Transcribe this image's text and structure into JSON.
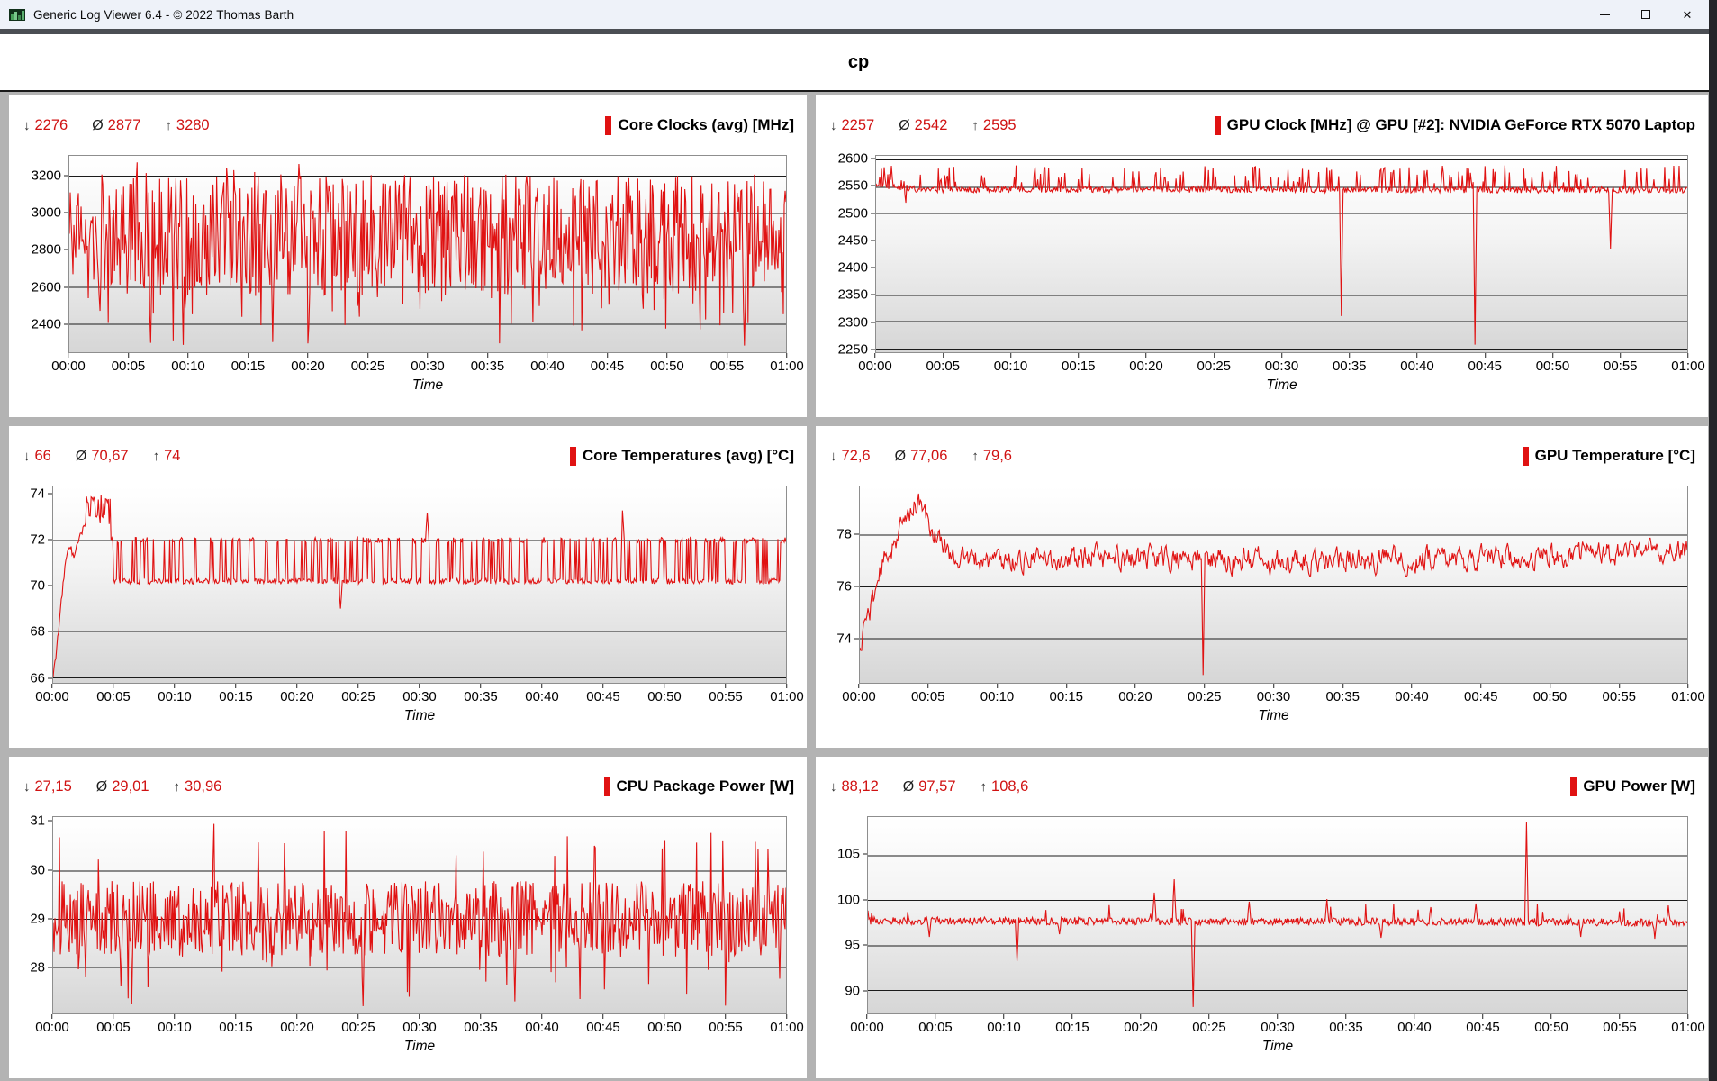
{
  "window": {
    "title": "Generic Log Viewer 6.4 - © 2022 Thomas Barth",
    "controls": {
      "minimize": "minimize",
      "maximize": "maximize",
      "close": "close",
      "close_glyph": "✕"
    }
  },
  "header": {
    "title": "cp"
  },
  "stats_symbols": {
    "min": "↓",
    "avg": "Ø",
    "max": "↑"
  },
  "colors": {
    "series_red": "#e01212",
    "stat_value_red": "#d01212",
    "grid_line": "#1b1b1b",
    "panel_bg": "#ffffff",
    "workspace_bg": "#b3b3b3"
  },
  "chart_data": [
    {
      "id": "core-clocks",
      "type": "line",
      "title": "Core Clocks (avg) [MHz]",
      "stats": {
        "min": "2276",
        "avg": "2877",
        "max": "3280"
      },
      "stats_numeric": {
        "min": 2276,
        "avg": 2877,
        "max": 3280
      },
      "y_ticks": [
        3200,
        3000,
        2800,
        2600,
        2400
      ],
      "y_range": [
        2245,
        3310
      ],
      "x_ticks": [
        "00:00",
        "00:05",
        "00:10",
        "00:15",
        "00:20",
        "00:25",
        "00:30",
        "00:35",
        "00:40",
        "00:45",
        "00:50",
        "00:55",
        "01:00"
      ],
      "x_label": "Time",
      "x_range_minutes": [
        0,
        60
      ],
      "profile": {
        "kind": "noise",
        "seed": 11,
        "base": 2880,
        "amp": 330,
        "high": {
          "p": 0.02,
          "range": [
            3180,
            3280
          ]
        },
        "low": {
          "p": 0.035,
          "range": [
            2380,
            2560
          ]
        },
        "deep": {
          "p": 0.006,
          "range": [
            2290,
            2420
          ]
        },
        "events": [
          [
            9.5,
            2285
          ],
          [
            17,
            2300
          ],
          [
            56.5,
            2281
          ]
        ],
        "clip": [
          2276,
          3280
        ]
      }
    },
    {
      "id": "gpu-clock",
      "type": "line",
      "title": "GPU Clock [MHz] @ GPU [#2]: NVIDIA GeForce RTX 5070 Laptop",
      "stats": {
        "min": "2257",
        "avg": "2542",
        "max": "2595"
      },
      "stats_numeric": {
        "min": 2257,
        "avg": 2542,
        "max": 2595
      },
      "y_ticks": [
        2600,
        2550,
        2500,
        2450,
        2400,
        2350,
        2300,
        2250
      ],
      "y_range": [
        2243,
        2607
      ],
      "x_ticks": [
        "00:00",
        "00:05",
        "00:10",
        "00:15",
        "00:20",
        "00:25",
        "00:30",
        "00:35",
        "00:40",
        "00:45",
        "00:50",
        "00:55",
        "01:00"
      ],
      "x_label": "Time",
      "x_range_minutes": [
        0,
        60
      ],
      "profile": {
        "kind": "flat",
        "seed": 22,
        "path": [
          [
            0,
            2554
          ],
          [
            1.5,
            2549
          ],
          [
            3,
            2545
          ],
          [
            60,
            2544
          ]
        ],
        "noise": 6,
        "spike": {
          "p": 0.16,
          "range": [
            12,
            45
          ]
        },
        "events": [
          [
            2.2,
            2520
          ],
          [
            34.4,
            2310
          ],
          [
            44.3,
            2257
          ],
          [
            54.3,
            2435
          ]
        ],
        "clip": [
          2257,
          2595
        ]
      }
    },
    {
      "id": "core-temperatures",
      "type": "line",
      "title": "Core Temperatures (avg) [°C]",
      "stats": {
        "min": "66",
        "avg": "70,67",
        "max": "74"
      },
      "stats_numeric": {
        "min": 66,
        "avg": 70.67,
        "max": 74
      },
      "y_ticks": [
        74,
        72,
        70,
        68,
        66
      ],
      "y_range": [
        65.75,
        74.35
      ],
      "x_ticks": [
        "00:00",
        "00:05",
        "00:10",
        "00:15",
        "00:20",
        "00:25",
        "00:30",
        "00:35",
        "00:40",
        "00:45",
        "00:50",
        "00:55",
        "01:00"
      ],
      "x_label": "Time",
      "x_range_minutes": [
        0,
        60
      ],
      "profile": {
        "kind": "square",
        "seed": 33,
        "ramp": [
          [
            0,
            66
          ],
          [
            0.4,
            67.8
          ],
          [
            0.9,
            70.5
          ],
          [
            1.3,
            71.9
          ],
          [
            1.7,
            71.2
          ],
          [
            2.1,
            72
          ],
          [
            2.6,
            72.6
          ]
        ],
        "burst_until": 4.7,
        "burst": [
          72.7,
          74.0
        ],
        "lo": 70.2,
        "hi": 72.0,
        "p_enter_hi": 0.22,
        "p_exit_hi": 0.45,
        "noise": 0.12,
        "events": [
          [
            23.5,
            69.0
          ],
          [
            30.6,
            73.2
          ],
          [
            46.6,
            73.3
          ]
        ],
        "clip": [
          66,
          74
        ]
      }
    },
    {
      "id": "gpu-temperature",
      "type": "line",
      "title": "GPU Temperature [°C]",
      "stats": {
        "min": "72,6",
        "avg": "77,06",
        "max": "79,6"
      },
      "stats_numeric": {
        "min": 72.6,
        "avg": 77.06,
        "max": 79.6
      },
      "y_ticks": [
        78,
        76,
        74
      ],
      "y_range": [
        72.3,
        79.85
      ],
      "x_ticks": [
        "00:00",
        "00:05",
        "00:10",
        "00:15",
        "00:20",
        "00:25",
        "00:30",
        "00:35",
        "00:40",
        "00:45",
        "00:50",
        "00:55",
        "01:00"
      ],
      "x_label": "Time",
      "x_range_minutes": [
        0,
        60
      ],
      "profile": {
        "kind": "wander",
        "seed": 44,
        "path": [
          [
            0,
            73.4
          ],
          [
            0.3,
            74.6
          ],
          [
            0.8,
            75.2
          ],
          [
            1.5,
            76.6
          ],
          [
            2.3,
            77.6
          ],
          [
            3.2,
            78.4
          ],
          [
            4.0,
            79.3
          ],
          [
            4.5,
            79.0
          ],
          [
            5.2,
            78.2
          ],
          [
            6.5,
            77.3
          ],
          [
            8,
            77.0
          ],
          [
            20,
            77.1
          ],
          [
            30,
            77.0
          ],
          [
            45,
            77.1
          ],
          [
            60,
            77.4
          ]
        ],
        "noise": 0.42,
        "events": [
          [
            24.9,
            72.6
          ]
        ],
        "clip": [
          72.6,
          79.6
        ]
      }
    },
    {
      "id": "cpu-package-power",
      "type": "line",
      "title": "CPU Package Power [W]",
      "stats": {
        "min": "27,15",
        "avg": "29,01",
        "max": "30,96"
      },
      "stats_numeric": {
        "min": 27.15,
        "avg": 29.01,
        "max": 30.96
      },
      "y_ticks": [
        31,
        30,
        29,
        28
      ],
      "y_range": [
        27.05,
        31.1
      ],
      "x_ticks": [
        "00:00",
        "00:05",
        "00:10",
        "00:15",
        "00:20",
        "00:25",
        "00:30",
        "00:35",
        "00:40",
        "00:45",
        "00:50",
        "00:55",
        "01:00"
      ],
      "x_label": "Time",
      "x_range_minutes": [
        0,
        60
      ],
      "profile": {
        "kind": "noise",
        "seed": 55,
        "base": 29.0,
        "amp": 0.78,
        "high": {
          "p": 0.03,
          "range": [
            30.1,
            30.9
          ]
        },
        "low": {
          "p": 0.03,
          "range": [
            27.5,
            28.2
          ]
        },
        "deep": {
          "p": 0.008,
          "range": [
            27.2,
            27.6
          ]
        },
        "events": [
          [
            13.2,
            30.96
          ],
          [
            25.4,
            27.2
          ],
          [
            37.8,
            27.3
          ]
        ],
        "clip": [
          27.15,
          30.96
        ]
      }
    },
    {
      "id": "gpu-power",
      "type": "line",
      "title": "GPU Power [W]",
      "stats": {
        "min": "88,12",
        "avg": "97,57",
        "max": "108,6"
      },
      "stats_numeric": {
        "min": 88.12,
        "avg": 97.57,
        "max": 108.6
      },
      "y_ticks": [
        105,
        100,
        95,
        90
      ],
      "y_range": [
        87.4,
        109.2
      ],
      "x_ticks": [
        "00:00",
        "00:05",
        "00:10",
        "00:15",
        "00:20",
        "00:25",
        "00:30",
        "00:35",
        "00:40",
        "00:45",
        "00:50",
        "00:55",
        "01:00"
      ],
      "x_label": "Time",
      "x_range_minutes": [
        0,
        60
      ],
      "profile": {
        "kind": "flat",
        "seed": 66,
        "path": [
          [
            0,
            97.7
          ],
          [
            60,
            97.5
          ]
        ],
        "noise": 0.42,
        "spike": {
          "p": 0.02,
          "range": [
            0.8,
            2.2
          ]
        },
        "events": [
          [
            4.5,
            95.9
          ],
          [
            10.9,
            93.2
          ],
          [
            14,
            96.2
          ],
          [
            21,
            100.8
          ],
          [
            22.4,
            102.3
          ],
          [
            23.8,
            88.12
          ],
          [
            27.9,
            99.8
          ],
          [
            33.6,
            100.1
          ],
          [
            37.6,
            95.8
          ],
          [
            41.2,
            99.2
          ],
          [
            44.5,
            99.6
          ],
          [
            48.2,
            108.6
          ],
          [
            52.2,
            95.9
          ],
          [
            57.6,
            95.7
          ],
          [
            58.6,
            99.4
          ]
        ],
        "clip": [
          88.12,
          108.6
        ]
      }
    }
  ]
}
